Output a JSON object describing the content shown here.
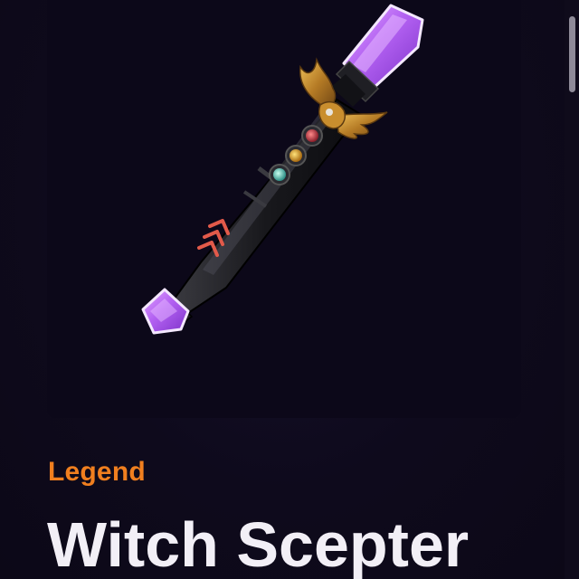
{
  "item": {
    "rarity": "Legend",
    "name": "Witch Scepter",
    "icon": "witch-scepter-icon"
  },
  "colors": {
    "background": "#0d0919",
    "rarity": "#f07f1f",
    "name": "#f2eff6",
    "crystal": "#b865f0",
    "handle": "#1d1d22",
    "wings": "#c38a2e"
  },
  "scroll": {
    "position": 0.0
  }
}
